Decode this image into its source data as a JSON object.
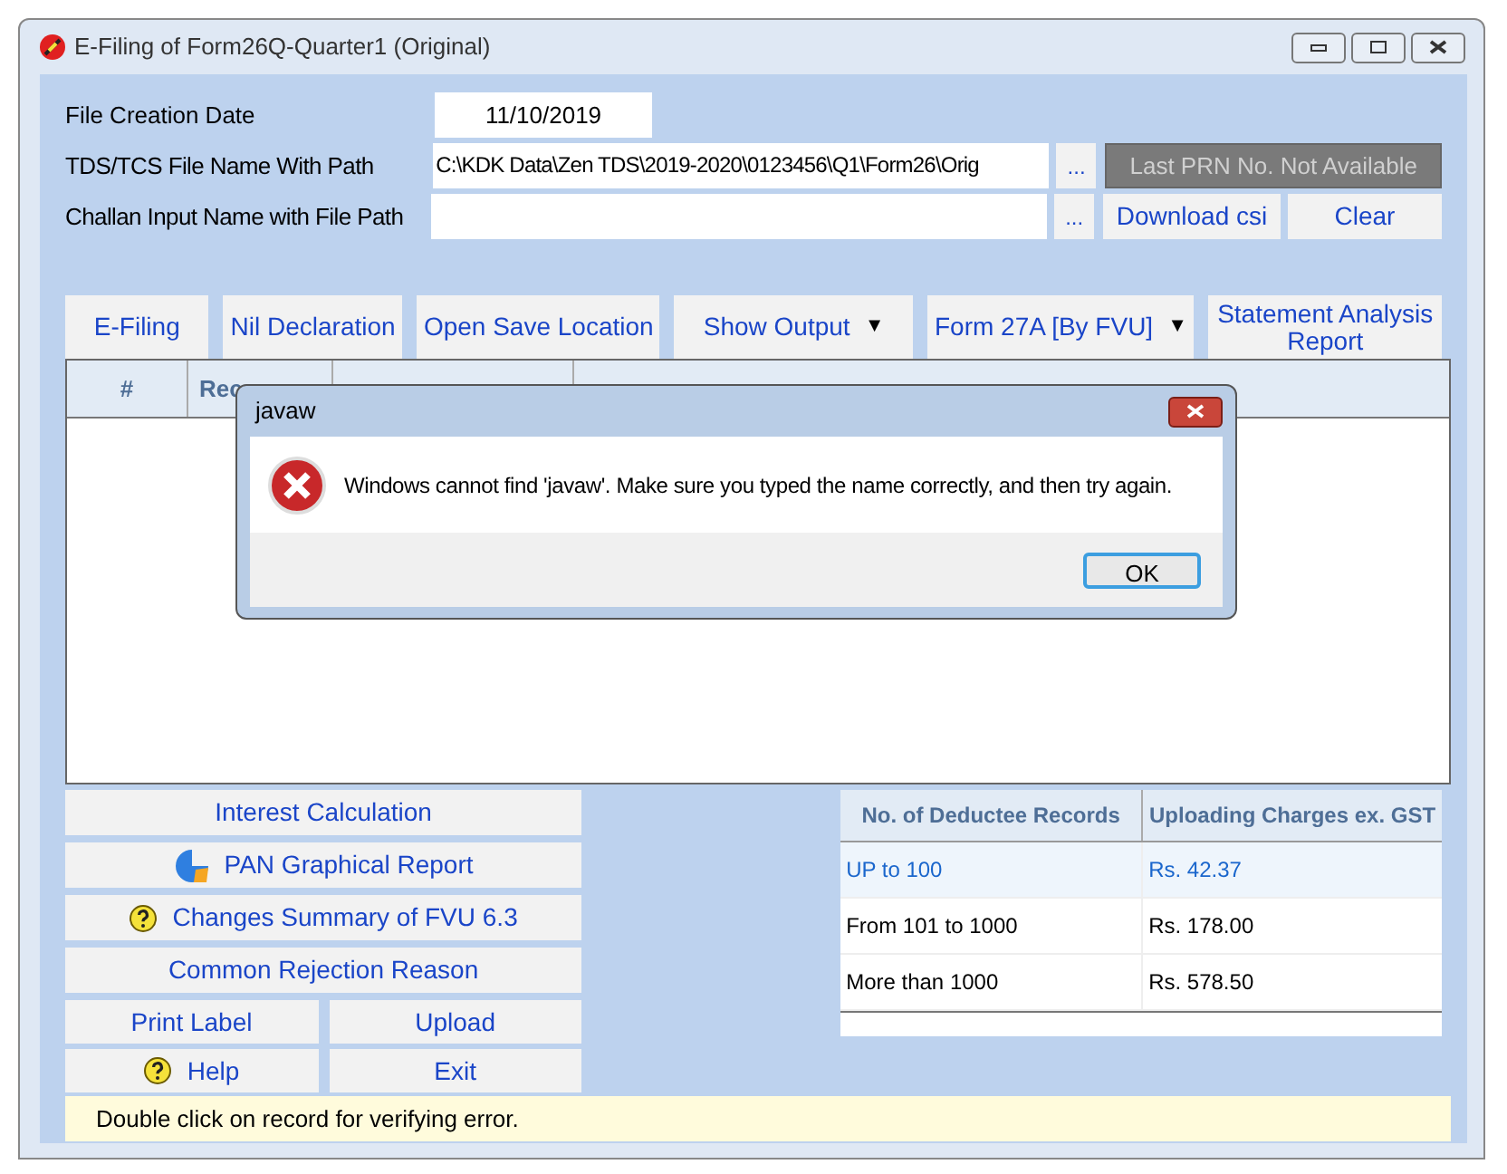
{
  "window": {
    "title": "E-Filing of Form26Q-Quarter1 (Original)"
  },
  "fields": [
    {
      "label": "File Creation Date",
      "value": "11/10/2019"
    },
    {
      "label": "TDS/TCS File Name With Path",
      "value": "C:\\KDK Data\\Zen TDS\\2019-2020\\0123456\\Q1\\Form26\\Orig",
      "browse": "..."
    },
    {
      "label": "Challan Input Name with File Path",
      "browse": "..."
    }
  ],
  "prn_button": {
    "label": "Last PRN No. Not Available",
    "disabled": true
  },
  "file_buttons": [
    "Download csi",
    "Clear"
  ],
  "toolbar": [
    {
      "label": "E-Filing",
      "dropdown": false
    },
    {
      "label": "Nil Declaration",
      "dropdown": false
    },
    {
      "label": "Open Save Location",
      "dropdown": false
    },
    {
      "label": "Show Output",
      "dropdown": true,
      "arrow": "▼"
    },
    {
      "label": "Form 27A [By FVU]",
      "dropdown": true,
      "arrow": "▼"
    },
    {
      "label": "Statement Analysis Report",
      "dropdown": false
    }
  ],
  "error_table": {
    "columns": [
      "#",
      "Rec"
    ]
  },
  "dialog": {
    "title": "javaw",
    "message": "Windows cannot find 'javaw'. Make sure you typed the name correctly, and then try again.",
    "button": "OK"
  },
  "side_buttons": [
    {
      "label": "Interest Calculation",
      "kind": "plain"
    },
    {
      "label": "PAN Graphical Report",
      "kind": "chart"
    },
    {
      "label": "Changes Summary of FVU 6.3",
      "kind": "help"
    },
    {
      "label": "Common Rejection Reason",
      "kind": "plain"
    }
  ],
  "pair_buttons": [
    {
      "label": "Print Label",
      "kind": "plain"
    },
    {
      "label": "Upload",
      "kind": "plain"
    },
    {
      "label": "Help",
      "kind": "help"
    },
    {
      "label": "Exit",
      "kind": "plain"
    }
  ],
  "charges_table": {
    "columns": [
      "No. of Deductee Records",
      "Uploading Charges ex. GST"
    ],
    "rows": [
      {
        "cells": [
          "UP to 100",
          "Rs. 42.37"
        ],
        "selected": true
      },
      {
        "cells": [
          "From 101 to 1000",
          "Rs. 178.00"
        ],
        "selected": false
      },
      {
        "cells": [
          "More than 1000",
          "Rs. 578.50"
        ],
        "selected": false
      }
    ]
  },
  "status_bar": "Double click on record for verifying error."
}
